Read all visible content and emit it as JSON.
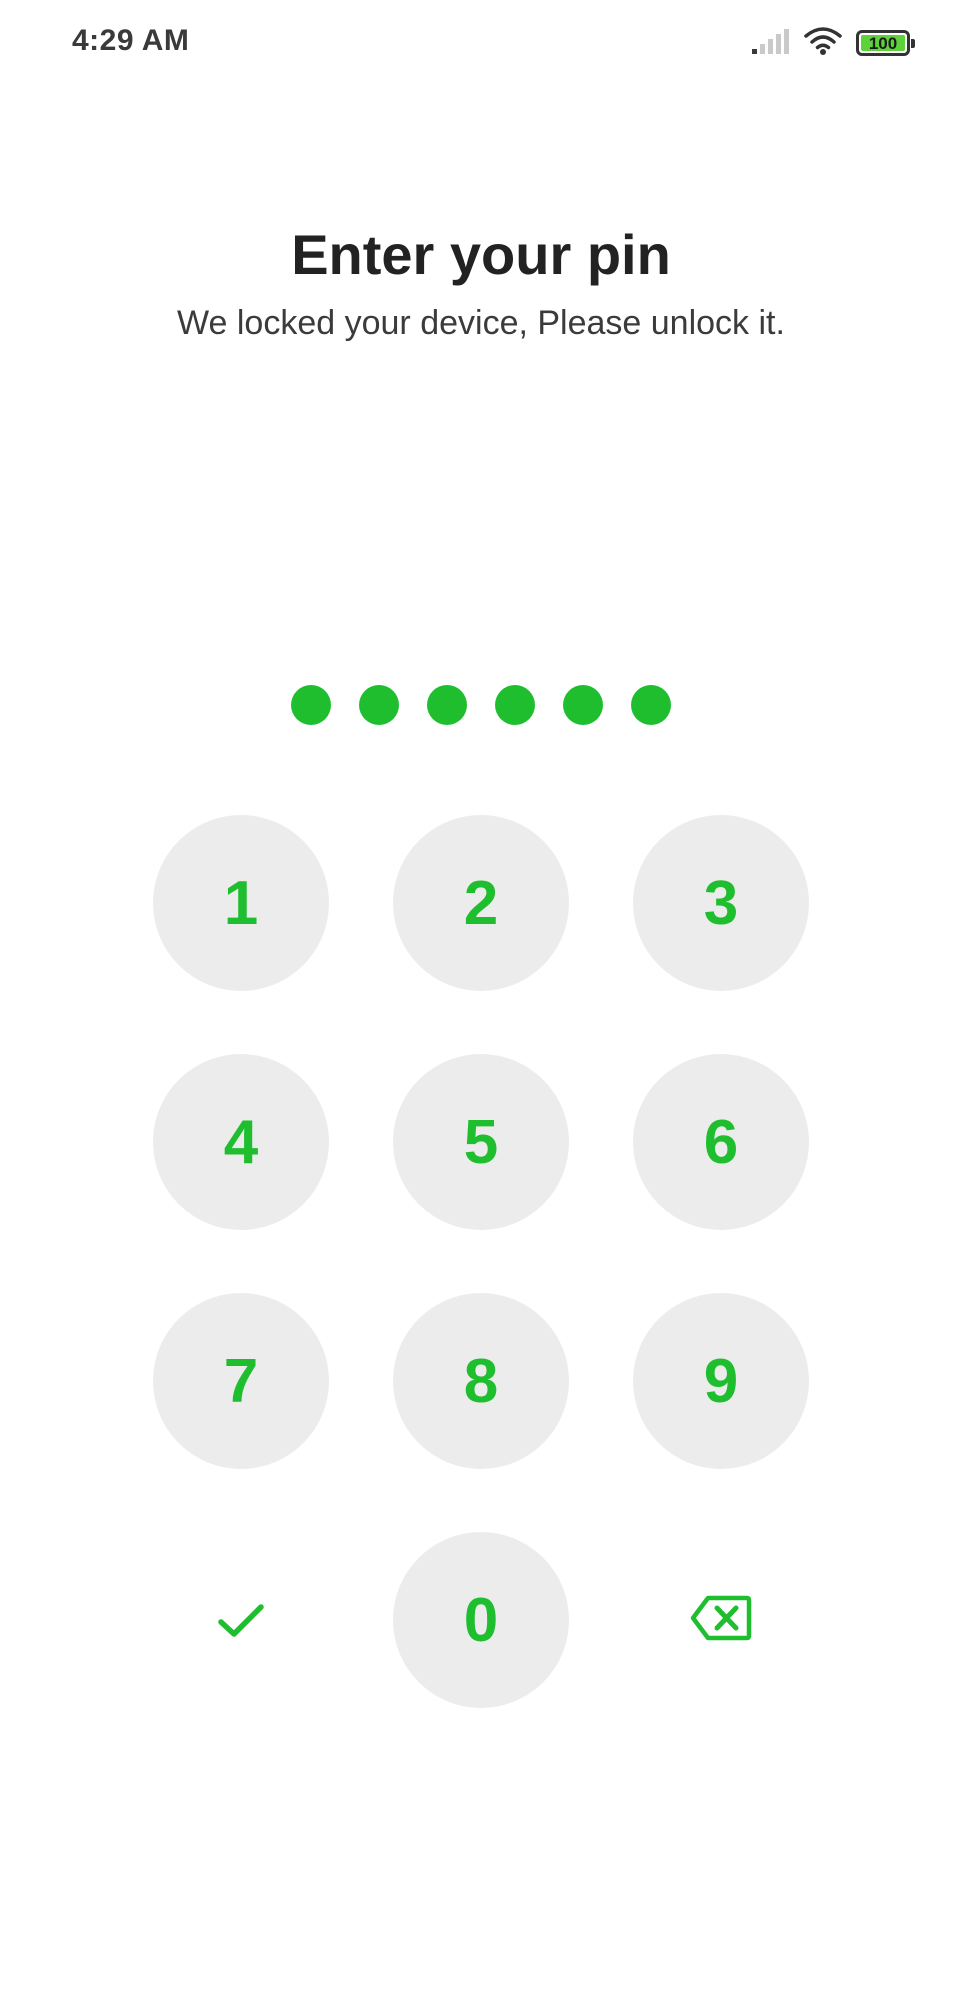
{
  "status_bar": {
    "time": "4:29 AM",
    "battery_level": "100",
    "icons": [
      "signal-icon",
      "wifi-icon",
      "battery-icon"
    ]
  },
  "lock_screen": {
    "title": "Enter your pin",
    "subtitle": "We locked your device, Please unlock it.",
    "entered_digits_count": 6
  },
  "keypad": {
    "keys": [
      "1",
      "2",
      "3",
      "4",
      "5",
      "6",
      "7",
      "8",
      "9"
    ],
    "zero": "0",
    "confirm_icon": "checkmark-icon",
    "backspace_icon": "backspace-icon"
  },
  "colors": {
    "accent": "#1fbe2e",
    "key_background": "#ececec",
    "title_text": "#222222",
    "background": "#ffffff"
  }
}
